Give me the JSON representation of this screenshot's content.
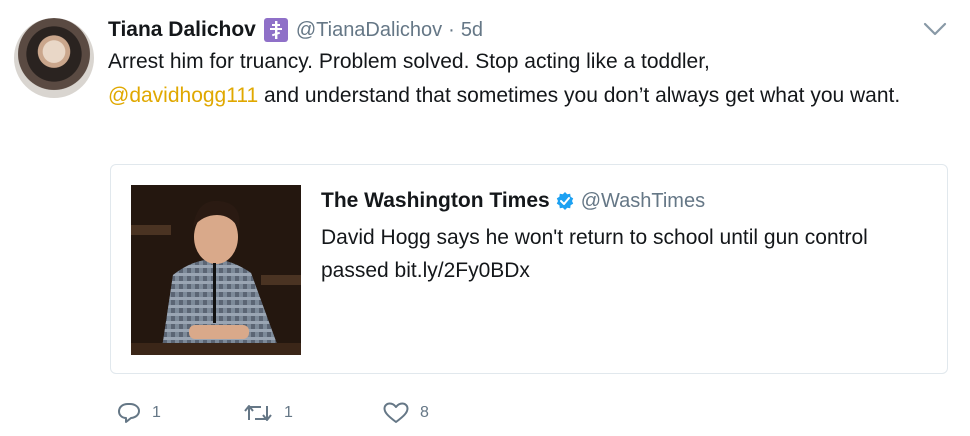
{
  "tweet": {
    "author_name": "Tiana Dalichov",
    "author_handle": "@TianaDalichov",
    "separator": "·",
    "time": "5d",
    "text_part1": "Arrest him for truancy. Problem solved. Stop acting like a toddler,",
    "mention": "@davidhogg111",
    "text_part2": " and understand that sometimes you don’t always get what you want."
  },
  "quoted": {
    "author_name": "The Washington Times",
    "author_handle": "@WashTimes",
    "text": "David Hogg says he won't return to school until gun control passed bit.ly/2Fy0BDx"
  },
  "actions": {
    "replies": "1",
    "retweets": "1",
    "likes": "8"
  },
  "colors": {
    "mention": "#e0a800",
    "secondary_text": "#657786",
    "verified": "#1da1f2",
    "badge": "#8f70c8"
  },
  "icons": [
    "avatar",
    "orthodox-cross-badge-icon",
    "chevron-down-icon",
    "verified-icon",
    "reply-icon",
    "retweet-icon",
    "like-icon"
  ]
}
